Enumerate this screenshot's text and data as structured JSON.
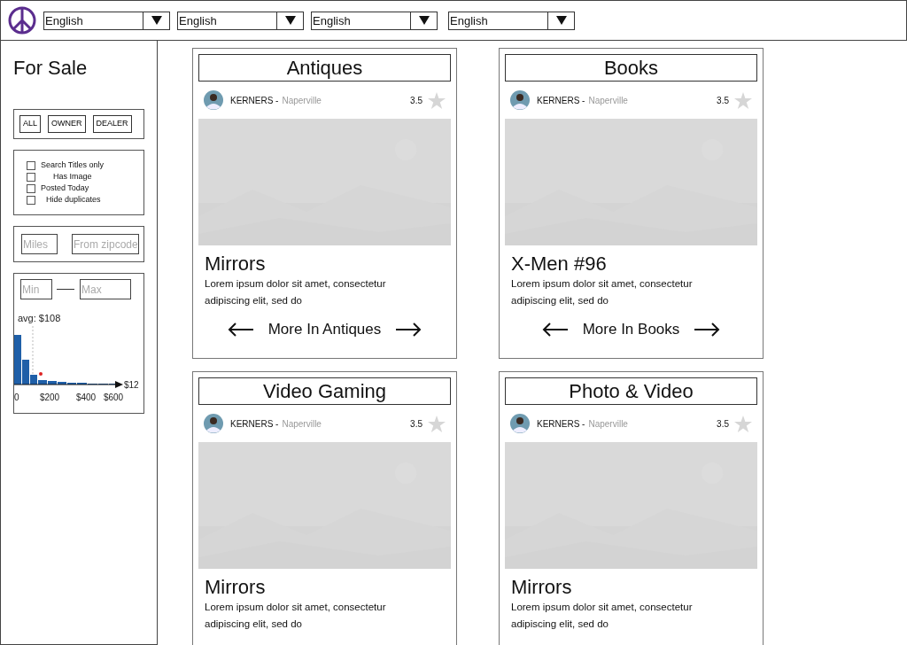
{
  "language_selects": [
    {
      "value": "English"
    },
    {
      "value": "English"
    },
    {
      "value": "English"
    },
    {
      "value": "English"
    }
  ],
  "sidebar": {
    "title": "For Sale",
    "seller_buttons": [
      "ALL",
      "OWNER",
      "DEALER"
    ],
    "options": [
      {
        "label": "Search Titles only",
        "checked": false
      },
      {
        "label": "Has Image",
        "checked": false
      },
      {
        "label": "Posted Today",
        "checked": false
      },
      {
        "label": "Hide duplicates",
        "checked": false
      }
    ],
    "distance": {
      "miles_placeholder": "Miles",
      "zip_placeholder": "From zipcode"
    },
    "price": {
      "min_placeholder": "Min",
      "max_placeholder": "Max",
      "avg_label": "avg: $108",
      "x_labels": [
        "0",
        "$200",
        "$400",
        "$600"
      ],
      "axis_end_label": "$12"
    }
  },
  "cards": [
    {
      "category": "Antiques",
      "seller": "KERNERS -",
      "location": "Naperville",
      "rating": "3.5",
      "item": "Mirrors",
      "description": "Lorem ipsum dolor sit amet, consectetur adipiscing elit, sed do",
      "more_label": "More In Antiques"
    },
    {
      "category": "Books",
      "seller": "KERNERS -",
      "location": "Naperville",
      "rating": "3.5",
      "item": "X-Men #96",
      "description": "Lorem ipsum dolor sit amet, consectetur adipiscing elit, sed do",
      "more_label": "More In Books"
    },
    {
      "category": "Video Gaming",
      "seller": "KERNERS -",
      "location": "Naperville",
      "rating": "3.5",
      "item": "Mirrors",
      "description": "Lorem ipsum dolor sit amet, consectetur adipiscing elit, sed do"
    },
    {
      "category": "Photo & Video",
      "seller": "KERNERS -",
      "location": "Naperville",
      "rating": "3.5",
      "item": "Mirrors",
      "description": "Lorem ipsum dolor sit amet, consectetur adipiscing elit, sed do"
    }
  ]
}
